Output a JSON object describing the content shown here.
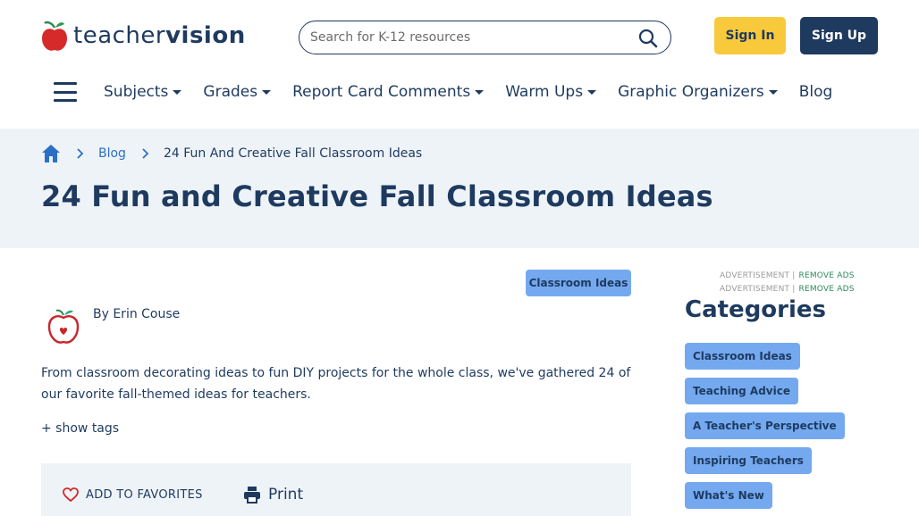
{
  "logo": {
    "text_light": "teacher",
    "text_bold": "vision"
  },
  "search": {
    "placeholder": "Search for K-12 resources"
  },
  "auth": {
    "signin_label": "Sign In",
    "signup_label": "Sign Up"
  },
  "nav": {
    "items": [
      {
        "label": "Subjects"
      },
      {
        "label": "Grades"
      },
      {
        "label": "Report Card Comments"
      },
      {
        "label": "Warm Ups"
      },
      {
        "label": "Graphic Organizers"
      },
      {
        "label": "Blog"
      }
    ]
  },
  "breadcrumb": {
    "items": [
      {
        "label": "Blog"
      },
      {
        "label": "24 Fun And Creative Fall Classroom Ideas"
      }
    ]
  },
  "article": {
    "title": "24 Fun and Creative Fall Classroom Ideas",
    "tag": "Classroom Ideas",
    "author": "By Erin Couse",
    "intro": "From classroom decorating ideas to fun DIY projects for the whole class, we've gathered 24 of our favorite fall-themed ideas for teachers.",
    "show_tags": "+ show tags",
    "favorites_label": "ADD TO FAVORITES",
    "print_label": "Print"
  },
  "sidebar": {
    "ad_label": "ADVERTISEMENT |",
    "remove_ads": "REMOVE ADS",
    "categories_title": "Categories",
    "categories": [
      {
        "label": "Classroom Ideas"
      },
      {
        "label": "Teaching Advice"
      },
      {
        "label": "A Teacher's Perspective"
      },
      {
        "label": "Inspiring Teachers"
      },
      {
        "label": "What's New"
      }
    ]
  },
  "colors": {
    "navy": "#1e3a5f",
    "accent_yellow": "#f9c93c",
    "tag_blue": "#74a9f0",
    "hero_bg": "#eef3f8",
    "link_blue": "#2c6fc7",
    "logo_red": "#d62a2a"
  }
}
